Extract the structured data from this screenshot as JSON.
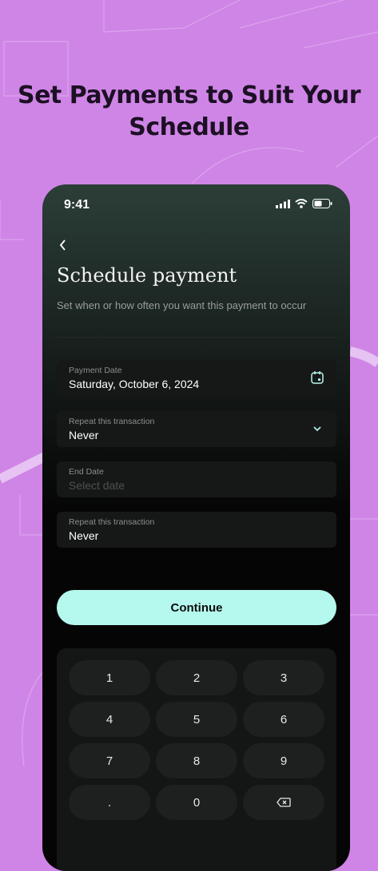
{
  "headline": {
    "line1": "Set Payments to Suit Your",
    "line2": "Schedule"
  },
  "status": {
    "time": "9:41"
  },
  "screen": {
    "title": "Schedule payment",
    "subtitle": "Set when or how often you want this payment to occur"
  },
  "fields": [
    {
      "label": "Payment Date",
      "value": "Saturday, October 6, 2024",
      "icon": "calendar-icon"
    },
    {
      "label": "Repeat this transaction",
      "value": "Never",
      "icon": "chevron-down-icon"
    },
    {
      "label": "End Date",
      "placeholder": "Select date"
    },
    {
      "label": "Repeat this transaction",
      "value": "Never"
    }
  ],
  "continue_label": "Continue",
  "keypad": {
    "keys": [
      "1",
      "2",
      "3",
      "4",
      "5",
      "6",
      "7",
      "8",
      "9",
      ".",
      "0"
    ],
    "backspace_icon": "backspace-icon"
  },
  "colors": {
    "background": "#cf85e6",
    "accent": "#b5f8ee",
    "card": "#161817"
  }
}
